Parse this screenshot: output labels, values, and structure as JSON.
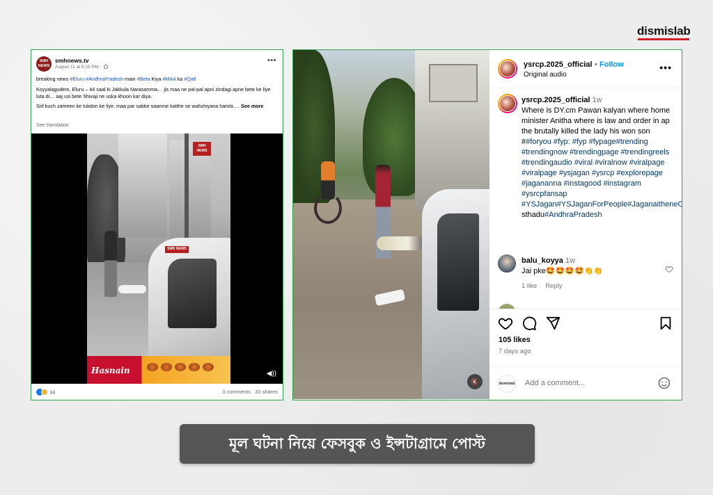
{
  "brand": {
    "logo_text": "dismislab",
    "accent": "#d11f2b"
  },
  "facebook_post": {
    "page_name": "smhnews.tv",
    "avatar_text": "SMH NEWS",
    "date": "August 11 at 5:15 PM",
    "line1_prefix": "breaking news",
    "line1_tags_a": "#Eluru #AndhraPradesh",
    "line1_mid": "main",
    "line1_tag_b": "#Beta",
    "line1_mid2": "Kiya",
    "line1_tag_c": "#MAA",
    "line1_mid3": "ka",
    "line1_tag_d": "#Qatl",
    "line2": "Koyyalagudem, Eluru – 44 saal ki Jakkula Narasamma… jis maa ne pal-pal apni zindagi apne bete ke liye luta di… aaj usi bete Shivaji ne uska khoon kar diya.",
    "line3": "Sirf kuch zameen ke tukdon ke liye, maa par sabke saamne katthe se wahshiyana hamla….",
    "see_more": "See more",
    "see_translation": "See translation",
    "watermark": "SMH NEWS",
    "ad_name": "Hasnain",
    "reaction_count": "34",
    "comments": "3 comments",
    "shares": "33 shares",
    "link_color": "#1e55c6"
  },
  "instagram_post": {
    "username": "ysrcp.2025_official",
    "dot": "•",
    "follow": "Follow",
    "audio": "Original audio",
    "caption_time": "1w",
    "caption_text": "Where is DY.cm Pawan kalyan where home minister Anitha where is law and order in ap the brutally killed the lady his won son #",
    "caption_tags": "#foryou #fyp: #fyp #fypage#trending #trendingnow #trendingpage #trendingreels #trendingaudio #viral #viralnow #viralpage #viralpage #ysjagan #ysrcp #explorepage #jagananna #instagood #instagram #ysrcpfansap #YSJagan#YSJaganForPeople#JaganaitheneChe",
    "caption_tail": "sthadu",
    "caption_tail_tag": "#AndhraPradesh",
    "comment_user": "balu_koyya",
    "comment_time": "1w",
    "comment_text": "Jai pke🤩🤩🤩🤩👏👏",
    "comment_likes": "1 like",
    "comment_reply": "Reply",
    "likes": "105 likes",
    "posted_ago": "7 days ago",
    "add_comment_placeholder": "Add a comment...",
    "add_comment_avatar_text": "dismislab",
    "follow_color": "#0095f6",
    "hashtag_color": "#00376b"
  },
  "caption_banner": {
    "text": "মূল ঘটনা নিয়ে ফেসবুক ও ইন্সটাগ্রামে পোস্ট"
  },
  "frame_color": "#2fa34b"
}
